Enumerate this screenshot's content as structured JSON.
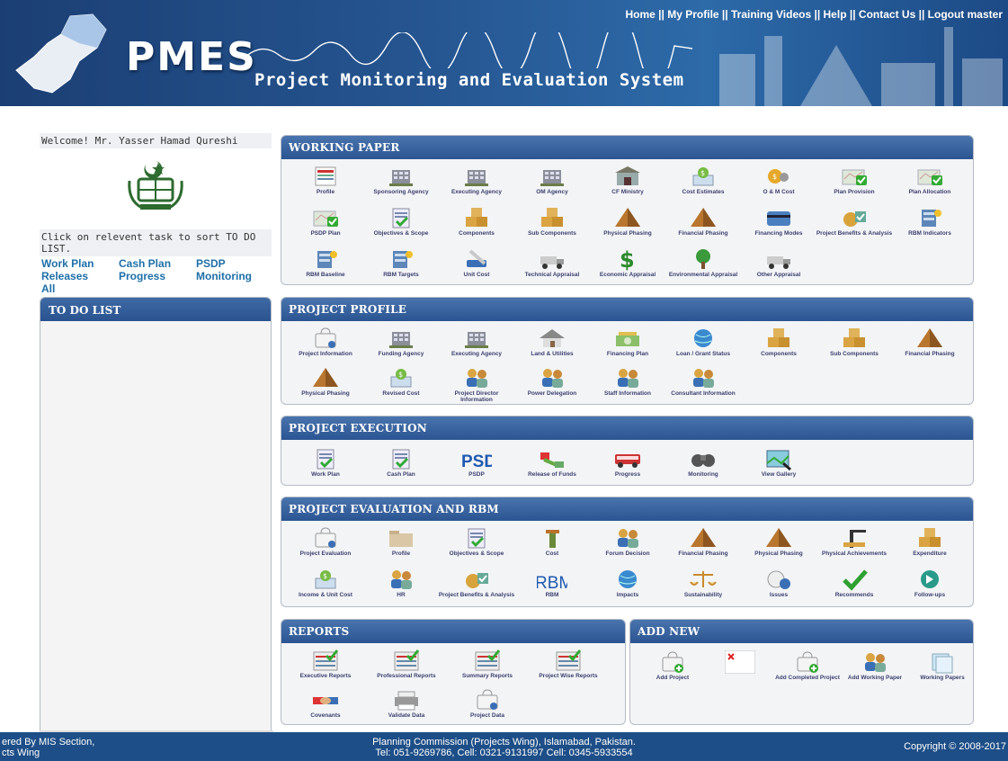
{
  "header": {
    "logo": "PMES",
    "subtitle": "Project Monitoring and Evaluation System",
    "links": [
      "Home",
      "My Profile",
      "Training Videos",
      "Help",
      "Contact Us",
      "Logout master"
    ]
  },
  "sidebar": {
    "welcome": "Welcome! Mr. Yasser Hamad Qureshi",
    "instruction": "Click on relevent task to sort TO DO LIST.",
    "filters": [
      "Work Plan",
      "Cash Plan",
      "PSDP",
      "Releases",
      "Progress",
      "Monitoring",
      "All"
    ],
    "todo_title": "TO DO LIST"
  },
  "working_paper": {
    "title": "WORKING PAPER",
    "items": [
      {
        "label": "Profile",
        "icon": "profile-icon"
      },
      {
        "label": "Sponsoring Agency",
        "icon": "building-icon"
      },
      {
        "label": "Executing Agency",
        "icon": "building-icon"
      },
      {
        "label": "OM Agency",
        "icon": "building-icon"
      },
      {
        "label": "CF Ministry",
        "icon": "ministry-icon"
      },
      {
        "label": "Cost Estimates",
        "icon": "cost-icon"
      },
      {
        "label": "O & M Cost",
        "icon": "coins-icon"
      },
      {
        "label": "Plan Provision",
        "icon": "map-check-icon"
      },
      {
        "label": "Plan Allocation",
        "icon": "map-check-icon"
      },
      {
        "label": "PSDP Plan",
        "icon": "map-check-icon"
      },
      {
        "label": "Objectives & Scope",
        "icon": "clipboard-icon"
      },
      {
        "label": "Components",
        "icon": "boxes-icon"
      },
      {
        "label": "Sub Components",
        "icon": "boxes-icon"
      },
      {
        "label": "Physical Phasing",
        "icon": "pyramid-icon"
      },
      {
        "label": "Financial Phasing",
        "icon": "pyramid-icon"
      },
      {
        "label": "Financing Modes",
        "icon": "card-icon"
      },
      {
        "label": "Project Benefits & Analysis",
        "icon": "benefits-icon"
      },
      {
        "label": "RBM Indicators",
        "icon": "rbm-icon"
      },
      {
        "label": "RBM Baseline",
        "icon": "rbm-icon"
      },
      {
        "label": "RBM Targets",
        "icon": "rbm-icon"
      },
      {
        "label": "Unit Cost",
        "icon": "tools-icon"
      },
      {
        "label": "Technical Appraisal",
        "icon": "truck-icon"
      },
      {
        "label": "Economic Appraisal",
        "icon": "dollar-icon"
      },
      {
        "label": "Environmental Appraisal",
        "icon": "tree-icon"
      },
      {
        "label": "Other Appraisal",
        "icon": "truck-icon"
      }
    ]
  },
  "project_profile": {
    "title": "PROJECT PROFILE",
    "items": [
      {
        "label": "Project Information",
        "icon": "bag-icon"
      },
      {
        "label": "Funding Agency",
        "icon": "building-icon"
      },
      {
        "label": "Executing Agency",
        "icon": "building-icon"
      },
      {
        "label": "Land & Utilities",
        "icon": "house-icon"
      },
      {
        "label": "Financing Plan",
        "icon": "money-icon"
      },
      {
        "label": "Loan / Grant Status",
        "icon": "globe-icon"
      },
      {
        "label": "Components",
        "icon": "boxes-icon"
      },
      {
        "label": "Sub Components",
        "icon": "boxes-icon"
      },
      {
        "label": "Financial Phasing",
        "icon": "pyramid-icon"
      },
      {
        "label": "Physical Phasing",
        "icon": "pyramid-icon"
      },
      {
        "label": "Revised Cost",
        "icon": "cost-icon"
      },
      {
        "label": "Project Director Information",
        "icon": "people-icon"
      },
      {
        "label": "Power Delegation",
        "icon": "people-icon"
      },
      {
        "label": "Staff Information",
        "icon": "people-icon"
      },
      {
        "label": "Consultant Information",
        "icon": "people-icon"
      }
    ]
  },
  "project_execution": {
    "title": "PROJECT EXECUTION",
    "items": [
      {
        "label": "Work Plan",
        "icon": "clipboard-icon"
      },
      {
        "label": "Cash Plan",
        "icon": "clipboard-icon"
      },
      {
        "label": "PSDP",
        "icon": "psdp-text-icon"
      },
      {
        "label": "Release of Funds",
        "icon": "release-icon"
      },
      {
        "label": "Progress",
        "icon": "bus-icon"
      },
      {
        "label": "Monitoring",
        "icon": "binoculars-icon"
      },
      {
        "label": "View Gallery",
        "icon": "gallery-icon"
      }
    ]
  },
  "project_evaluation": {
    "title": "PROJECT EVALUATION AND RBM",
    "items": [
      {
        "label": "Project Evaluation",
        "icon": "bag-icon"
      },
      {
        "label": "Profile",
        "icon": "folder-icon"
      },
      {
        "label": "Objectives & Scope",
        "icon": "clipboard-icon"
      },
      {
        "label": "Cost",
        "icon": "tower-icon"
      },
      {
        "label": "Forum Decision",
        "icon": "people-icon"
      },
      {
        "label": "Financial Phasing",
        "icon": "pyramid-icon"
      },
      {
        "label": "Physical Phasing",
        "icon": "pyramid-icon"
      },
      {
        "label": "Physical Achievements",
        "icon": "crane-icon"
      },
      {
        "label": "Expenditure",
        "icon": "boxes-icon"
      },
      {
        "label": "Income & Unit Cost",
        "icon": "cost-icon"
      },
      {
        "label": "HR",
        "icon": "people-icon"
      },
      {
        "label": "Project Benefits & Analysis",
        "icon": "benefits-icon"
      },
      {
        "label": "RBM",
        "icon": "rbm-text-icon"
      },
      {
        "label": "Impacts",
        "icon": "globe-icon"
      },
      {
        "label": "Sustainability",
        "icon": "scales-icon"
      },
      {
        "label": "Issues",
        "icon": "issue-icon"
      },
      {
        "label": "Recommends",
        "icon": "check-icon"
      },
      {
        "label": "Follow-ups",
        "icon": "forward-icon"
      }
    ]
  },
  "reports": {
    "title": "REPORTS",
    "items": [
      {
        "label": "Executive Reports",
        "icon": "report-icon"
      },
      {
        "label": "Professional Reports",
        "icon": "report-icon"
      },
      {
        "label": "Summary Reports",
        "icon": "report-icon"
      },
      {
        "label": "Project Wise Reports",
        "icon": "report-icon"
      },
      {
        "label": "Covenants",
        "icon": "handshake-icon"
      },
      {
        "label": "Validate Data",
        "icon": "printer-icon"
      },
      {
        "label": "Project Data",
        "icon": "bag-icon"
      }
    ]
  },
  "add_new": {
    "title": "ADD NEW",
    "items": [
      {
        "label": "Add Project",
        "icon": "bag-add-icon"
      },
      {
        "label": "",
        "icon": "broken-image-icon"
      },
      {
        "label": "Add Completed Project",
        "icon": "bag-add-icon"
      },
      {
        "label": "Add Working Paper",
        "icon": "people-icon"
      },
      {
        "label": "Working Papers",
        "icon": "papers-icon"
      }
    ]
  },
  "footer": {
    "left1": "ered By MIS Section,",
    "left2": "cts Wing",
    "center1": "Planning Commission (Projects Wing), Islamabad, Pakistan.",
    "center2": "Tel: 051-9269786, Cell: 0321-9131997   Cell: 0345-5933554",
    "right": "Copyright © 2008-2017"
  },
  "colors": {
    "header": "#25548f",
    "bar": "#2b5592",
    "link": "#1e6fa8",
    "footer": "#1d4e87"
  }
}
